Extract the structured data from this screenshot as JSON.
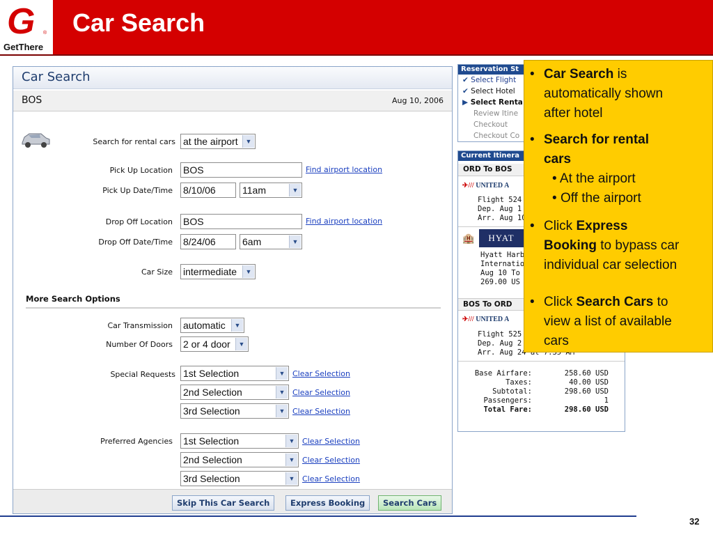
{
  "slide": {
    "brand": "GetThere",
    "title": "Car Search",
    "page_number": "32"
  },
  "form": {
    "header": "Car Search",
    "location_code": "BOS",
    "date": "Aug 10, 2006",
    "search_label": "Search for rental cars",
    "search_value": "at the airport",
    "pickup_location_label": "Pick Up Location",
    "pickup_location_value": "BOS",
    "find_airport_link": "Find airport location",
    "pickup_datetime_label": "Pick Up Date/Time",
    "pickup_date": "8/10/06",
    "pickup_time": "11am",
    "dropoff_location_label": "Drop Off Location",
    "dropoff_location_value": "BOS",
    "dropoff_datetime_label": "Drop Off Date/Time",
    "dropoff_date": "8/24/06",
    "dropoff_time": "6am",
    "car_size_label": "Car Size",
    "car_size_value": "intermediate",
    "more_options_label": "More Search Options",
    "transmission_label": "Car Transmission",
    "transmission_value": "automatic",
    "doors_label": "Number Of Doors",
    "doors_value": "2 or 4 door",
    "special_requests_label": "Special Requests",
    "preferred_agencies_label": "Preferred Agencies",
    "selection_1": "1st Selection",
    "selection_2": "2nd Selection",
    "selection_3": "3rd Selection",
    "clear_selection": "Clear Selection",
    "skip_button": "Skip This Car Search",
    "express_button": "Express Booking",
    "search_button": "Search Cars"
  },
  "reservation_status": {
    "title": "Reservation St",
    "steps": [
      "Select Flight",
      "Select Hotel",
      "Select Renta",
      "Review Itine",
      "Checkout",
      "Checkout Co"
    ]
  },
  "itinerary": {
    "title": "Current Itinera",
    "leg1": "ORD To BOS",
    "airline": "UNITED A",
    "flight1": [
      "Flight 524",
      "Dep. Aug 1",
      "Arr. Aug 10"
    ],
    "hotel_brand": "HYAT",
    "hotel": [
      "Hyatt Harb",
      "Internation",
      "Aug 10 To",
      "269.00 US"
    ],
    "leg2": "BOS To ORD",
    "flight2": [
      "Flight 525",
      "Dep. Aug 2",
      "Arr. Aug 24 at 7:35 AM"
    ],
    "fares": {
      "labels": [
        "Base Airfare:",
        "Taxes:",
        "Subtotal:",
        "Passengers:",
        "Total Fare:"
      ],
      "values": [
        "258.60 USD",
        "40.00 USD",
        "298.60 USD",
        "1",
        "298.60 USD"
      ]
    }
  },
  "callout": {
    "b1_bold": "Car Search",
    "b1_rest_1": " is",
    "b1_rest_2": "automatically shown",
    "b1_rest_3": "after hotel",
    "b2_bold_1": "Search for rental",
    "b2_bold_2": "cars",
    "b2_sub_1": "At the airport",
    "b2_sub_2": "Off the airport",
    "b3_pre": "Click ",
    "b3_bold_1": "Express",
    "b3_bold_2": "Booking",
    "b3_rest_1": " to bypass car",
    "b3_rest_2": "individual car selection",
    "b4_pre": "Click ",
    "b4_bold": "Search Cars",
    "b4_rest_1": " to",
    "b4_rest_2": "view a list of available",
    "b4_rest_3": "cars"
  },
  "colors": {
    "brand_red": "#d40000",
    "callout_yellow": "#ffcc00",
    "panel_blue": "#1f4a8f",
    "link_blue": "#1a3fbf"
  }
}
